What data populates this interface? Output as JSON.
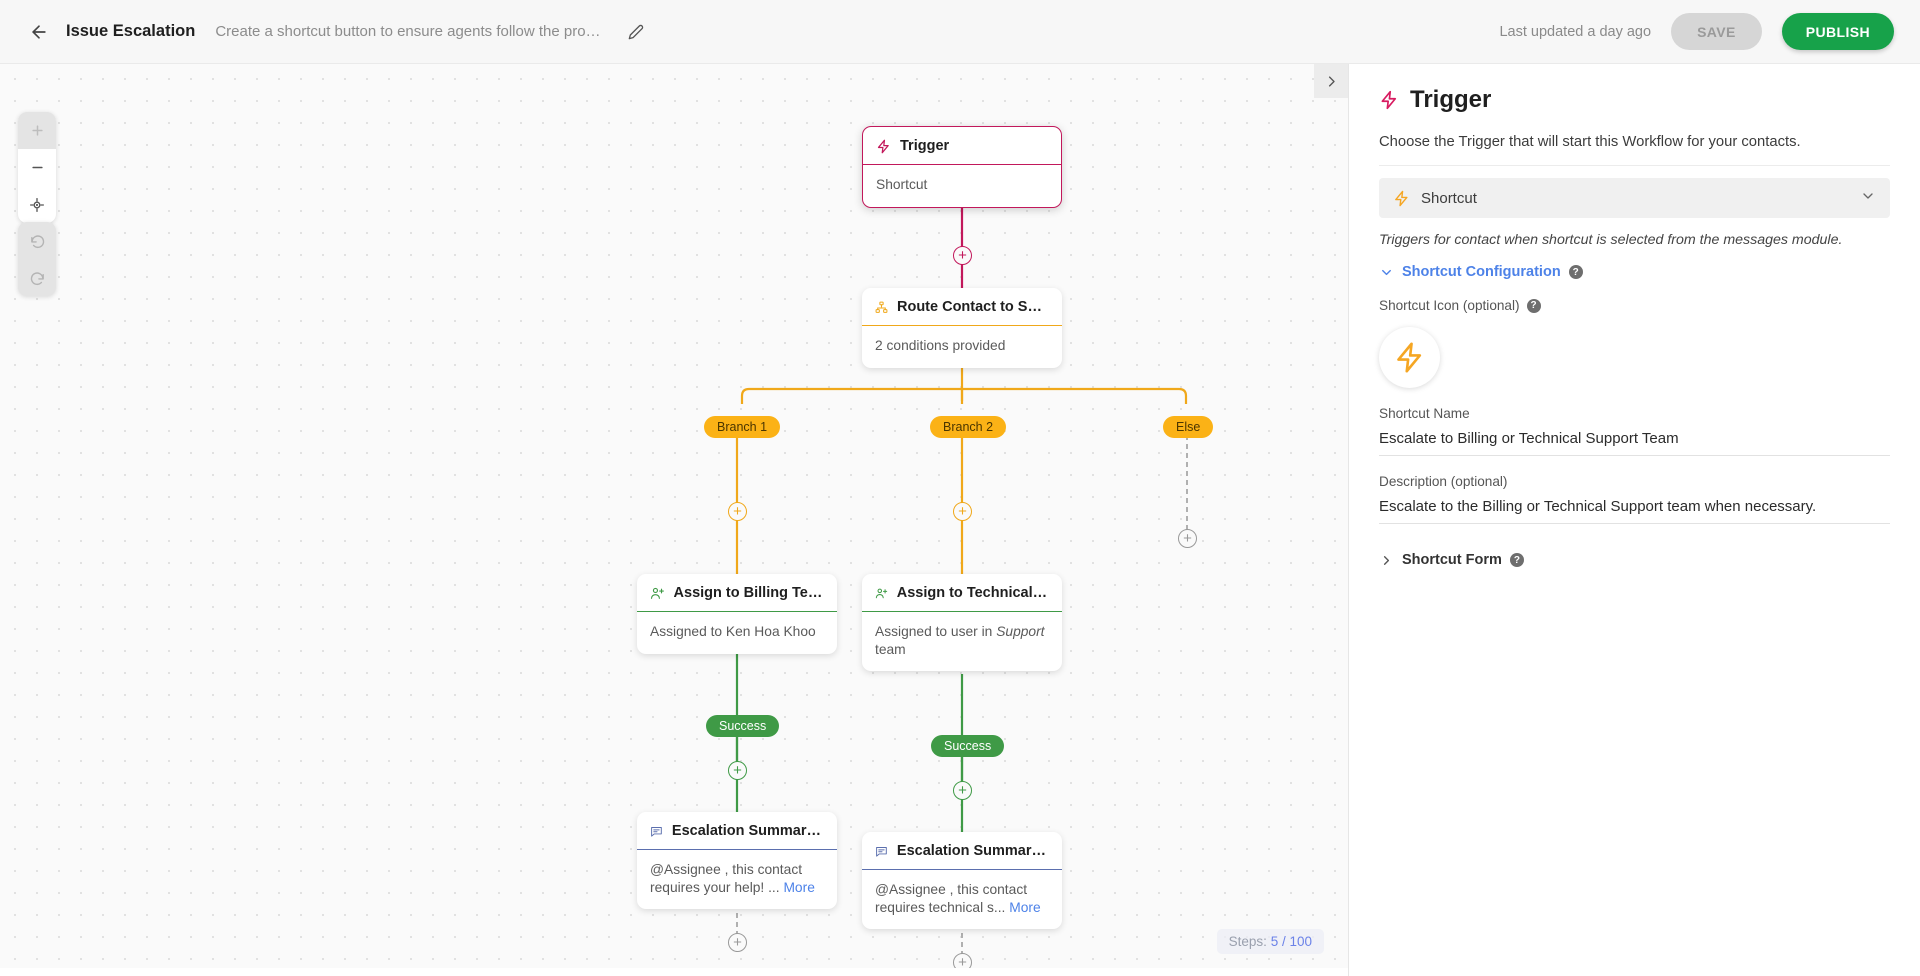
{
  "header": {
    "back_icon": "arrow-left-icon",
    "workflow_title": "Issue Escalation",
    "workflow_description": "Create a shortcut button to ensure agents follow the process &...",
    "edit_icon": "pencil-icon",
    "last_updated": "Last updated a day ago",
    "save_label": "SAVE",
    "publish_label": "PUBLISH"
  },
  "canvas": {
    "zoom_in_icon": "plus-icon",
    "zoom_out_icon": "minus-icon",
    "recenter_icon": "crosshair-icon",
    "undo_icon": "undo-icon",
    "redo_icon": "redo-icon",
    "panel_toggle_icon": "chevron-right-icon",
    "steps_prefix": "Steps:",
    "steps_value": "5 / 100"
  },
  "flow": {
    "nodes": [
      {
        "id": "trigger",
        "icon": "lightning-icon",
        "title": "Trigger",
        "body": "Shortcut",
        "accent": "#c2185b",
        "selected": true
      },
      {
        "id": "route",
        "icon": "sitemap-icon",
        "title": "Route Contact to Select...",
        "body": "2 conditions provided",
        "accent": "#f0a81a",
        "selected": false
      },
      {
        "id": "assign-billing",
        "icon": "user-plus-icon",
        "title": "Assign to Billing Team",
        "body": "Assigned to Ken Hoa Khoo",
        "accent": "#3f9a46",
        "selected": false
      },
      {
        "id": "assign-technical",
        "icon": "user-plus-icon",
        "title": "Assign to Technical Sup...",
        "body_pre": "Assigned to user in ",
        "body_em": "Support",
        "body_post": " team",
        "accent": "#3f9a46",
        "selected": false
      },
      {
        "id": "summary-billing",
        "icon": "note-icon",
        "title": "Escalation Summary to ...",
        "body_pre": "@Assignee , this contact requires your help! ... ",
        "body_link": "More",
        "accent": "#5b6fae",
        "selected": false
      },
      {
        "id": "summary-technical",
        "icon": "note-icon",
        "title": "Escalation Summary to ...",
        "body_pre": "@Assignee , this contact requires technical s... ",
        "body_link": "More",
        "accent": "#5b6fae",
        "selected": false
      }
    ],
    "branch_labels": [
      "Branch 1",
      "Branch 2",
      "Else"
    ],
    "success_labels": [
      "Success",
      "Success"
    ],
    "add_step_glyph": "+"
  },
  "panel": {
    "icon": "lightning-icon",
    "title": "Trigger",
    "subtitle": "Choose the Trigger that will start this Workflow for your contacts.",
    "trigger_select": {
      "icon": "lightning-icon",
      "value": "Shortcut",
      "chevron": "chevron-down-icon"
    },
    "trigger_note": "Triggers for contact when shortcut is selected from the messages module.",
    "shortcut_config": {
      "label": "Shortcut Configuration",
      "chevron": "chevron-down-icon",
      "help": "?"
    },
    "shortcut_icon_field": {
      "label": "Shortcut Icon (optional)",
      "help": "?",
      "icon": "lightning-icon"
    },
    "shortcut_name": {
      "label": "Shortcut Name",
      "value": "Escalate to Billing or Technical Support Team"
    },
    "description": {
      "label": "Description (optional)",
      "value": "Escalate to the Billing or Technical Support team when necessary."
    },
    "shortcut_form": {
      "label": "Shortcut Form",
      "chevron": "chevron-right-icon",
      "help": "?"
    }
  },
  "colors": {
    "crimson": "#c2185b",
    "amber": "#f0a81a",
    "green": "#3f9a46",
    "blue": "#4d82e8",
    "publish_green": "#17a24a"
  }
}
